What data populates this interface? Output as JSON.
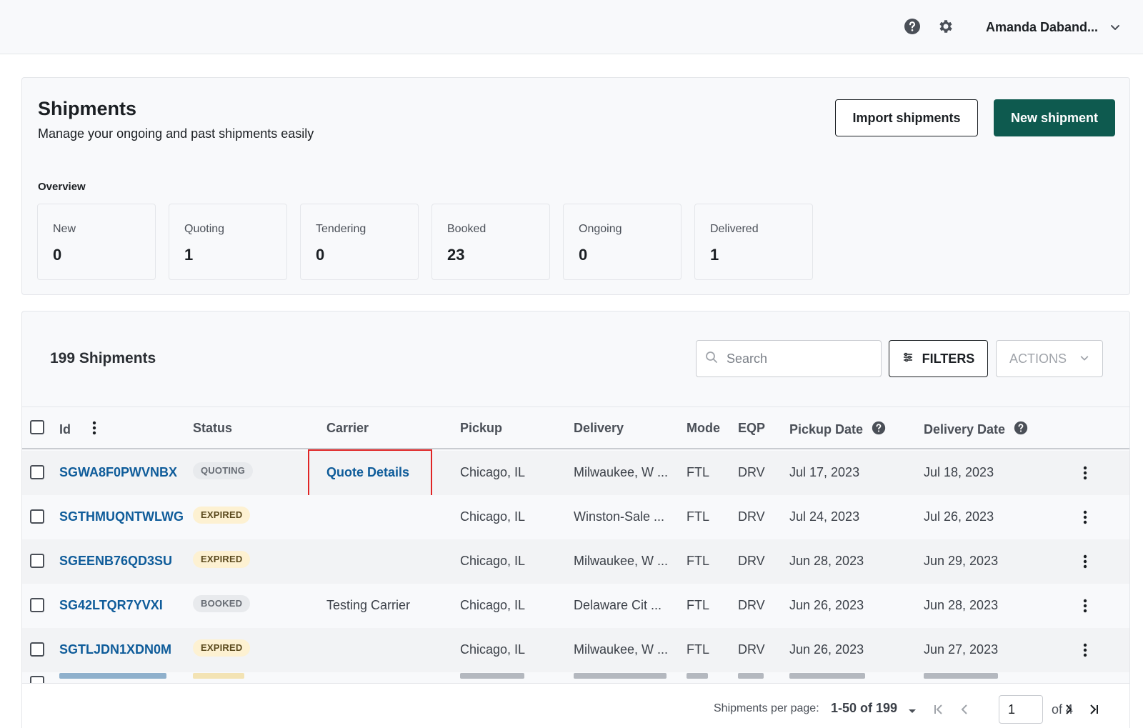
{
  "topbar": {
    "icons": [
      "help-circle-icon",
      "gear-icon",
      "chevron-down-icon"
    ],
    "user_name": "Amanda Daband..."
  },
  "header": {
    "title": "Shipments",
    "subtitle": "Manage your ongoing and past shipments easily",
    "import_label": "Import shipments",
    "new_label": "New shipment"
  },
  "overview": {
    "label": "Overview",
    "stats": [
      {
        "label": "New",
        "value": "0"
      },
      {
        "label": "Quoting",
        "value": "1"
      },
      {
        "label": "Tendering",
        "value": "0"
      },
      {
        "label": "Booked",
        "value": "23"
      },
      {
        "label": "Ongoing",
        "value": "0"
      },
      {
        "label": "Delivered",
        "value": "1"
      }
    ]
  },
  "table": {
    "count_title": "199 Shipments",
    "search_placeholder": "Search",
    "filters_label": "FILTERS",
    "actions_label": "ACTIONS",
    "columns": {
      "id": "Id",
      "status": "Status",
      "carrier": "Carrier",
      "pickup": "Pickup",
      "delivery": "Delivery",
      "mode": "Mode",
      "eqp": "EQP",
      "pickup_date": "Pickup Date",
      "delivery_date": "Delivery Date"
    },
    "rows": [
      {
        "id": "SGWA8F0PWVNBX",
        "status": "QUOTING",
        "carrier": "Quote Details",
        "pickup": "Chicago, IL",
        "delivery": "Milwaukee, W ...",
        "mode": "FTL",
        "eqp": "DRV",
        "pickup_date": "Jul 17, 2023",
        "delivery_date": "Jul 18, 2023"
      },
      {
        "id": "SGTHMUQNTWLWG",
        "status": "EXPIRED",
        "carrier": "",
        "pickup": "Chicago, IL",
        "delivery": "Winston-Sale ...",
        "mode": "FTL",
        "eqp": "DRV",
        "pickup_date": "Jul 24, 2023",
        "delivery_date": "Jul 26, 2023"
      },
      {
        "id": "SGEENB76QD3SU",
        "status": "EXPIRED",
        "carrier": "",
        "pickup": "Chicago, IL",
        "delivery": "Milwaukee, W ...",
        "mode": "FTL",
        "eqp": "DRV",
        "pickup_date": "Jun 28, 2023",
        "delivery_date": "Jun 29, 2023"
      },
      {
        "id": "SG42LTQR7YVXI",
        "status": "BOOKED",
        "carrier": "Testing Carrier",
        "pickup": "Chicago, IL",
        "delivery": "Delaware Cit ...",
        "mode": "FTL",
        "eqp": "DRV",
        "pickup_date": "Jun 26, 2023",
        "delivery_date": "Jun 28, 2023"
      },
      {
        "id": "SGTLJDN1XDN0M",
        "status": "EXPIRED",
        "carrier": "",
        "pickup": "Chicago, IL",
        "delivery": "Milwaukee, W ...",
        "mode": "FTL",
        "eqp": "DRV",
        "pickup_date": "Jun 26, 2023",
        "delivery_date": "Jun 27, 2023"
      }
    ]
  },
  "pagination": {
    "per_page_label": "Shipments per page:",
    "range": "1-50 of 199",
    "current_page": "1",
    "of_pages": "of 4"
  },
  "colors": {
    "primary_button": "#0e5a4f",
    "link": "#0f5c9a",
    "expired_badge_bg": "#fdf1d2",
    "neutral_badge_bg": "#e8eaed",
    "highlight_box": "#e02424"
  }
}
